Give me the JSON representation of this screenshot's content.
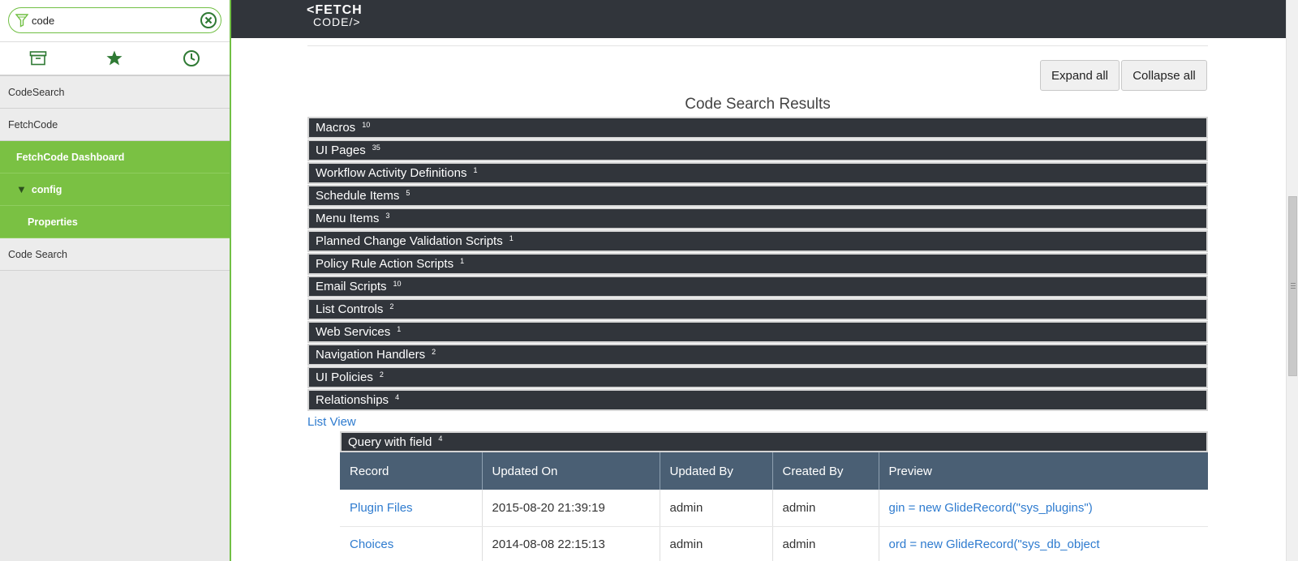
{
  "sidebar": {
    "filter_value": "code",
    "icons": [
      "archive-icon",
      "star-icon",
      "clock-icon"
    ],
    "items": [
      {
        "label": "CodeSearch"
      },
      {
        "label": "FetchCode"
      },
      {
        "label": "FetchCode Dashboard"
      },
      {
        "label": "config"
      },
      {
        "label": "Properties"
      },
      {
        "label": "Code Search"
      }
    ]
  },
  "header": {
    "logo_line1": "<FETCH",
    "logo_line2": "CODE/>"
  },
  "toolbar": {
    "expand_label": "Expand all",
    "collapse_label": "Collapse all"
  },
  "results": {
    "title": "Code Search Results",
    "categories": [
      {
        "label": "Macros",
        "count": "10"
      },
      {
        "label": "UI Pages",
        "count": "35"
      },
      {
        "label": "Workflow Activity Definitions",
        "count": "1"
      },
      {
        "label": "Schedule Items",
        "count": "5"
      },
      {
        "label": "Menu Items",
        "count": "3"
      },
      {
        "label": "Planned Change Validation Scripts",
        "count": "1"
      },
      {
        "label": "Policy Rule Action Scripts",
        "count": "1"
      },
      {
        "label": "Email Scripts",
        "count": "10"
      },
      {
        "label": "List Controls",
        "count": "2"
      },
      {
        "label": "Web Services",
        "count": "1"
      },
      {
        "label": "Navigation Handlers",
        "count": "2"
      },
      {
        "label": "UI Policies",
        "count": "2"
      },
      {
        "label": "Relationships",
        "count": "4"
      }
    ],
    "list_view_label": "List View",
    "group": {
      "label": "Query with field",
      "count": "4"
    },
    "columns": [
      "Record",
      "Updated On",
      "Updated By",
      "Created By",
      "Preview"
    ],
    "rows": [
      {
        "record": "Plugin Files",
        "updated_on": "2015-08-20 21:39:19",
        "updated_by": "admin",
        "created_by": "admin",
        "preview": "gin = new GlideRecord(\"sys_plugins\")"
      },
      {
        "record": "Choices",
        "updated_on": "2014-08-08 22:15:13",
        "updated_by": "admin",
        "created_by": "admin",
        "preview": "ord = new GlideRecord(\"sys_db_object"
      }
    ]
  },
  "colors": {
    "accent_green": "#7ac143",
    "topbar": "#31353b",
    "table_header": "#4a5f74",
    "link": "#2e7bcf"
  }
}
